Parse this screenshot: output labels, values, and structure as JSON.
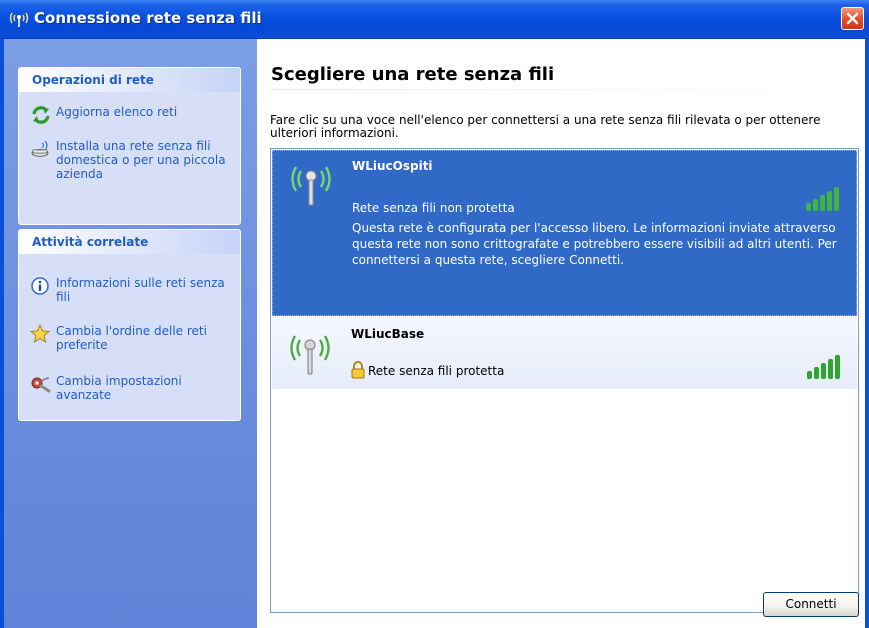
{
  "window": {
    "title": "Connessione rete senza fili"
  },
  "sidebar": {
    "network_tasks": {
      "header": "Operazioni di rete",
      "items": [
        {
          "label": "Aggiorna elenco reti",
          "icon": "refresh-icon"
        },
        {
          "label": "Installa una rete senza fili domestica o per una piccola azienda",
          "icon": "wireless-setup-icon"
        }
      ]
    },
    "related_tasks": {
      "header": "Attività correlate",
      "items": [
        {
          "label": "Informazioni sulle reti senza fili",
          "icon": "info-icon"
        },
        {
          "label": "Cambia l'ordine delle reti preferite",
          "icon": "star-icon"
        },
        {
          "label": "Cambia impostazioni avanzate",
          "icon": "settings-icon"
        }
      ]
    }
  },
  "main": {
    "title": "Scegliere una rete senza fili",
    "instructions": "Fare clic su una voce nell'elenco per connettersi a una rete senza fili rilevata o per ottenere ulteriori informazioni.",
    "networks": [
      {
        "ssid": "WLiucOspiti",
        "security": "Rete senza fili non protetta",
        "description": "Questa rete è configurata per l'accesso libero. Le informazioni inviate attraverso questa rete non sono crittografate e potrebbero essere visibili ad altri utenti. Per connettersi a questa rete, scegliere Connetti.",
        "selected": true,
        "signal_bars": 5
      },
      {
        "ssid": "WLiucBase",
        "security": "Rete senza fili protetta",
        "selected": false,
        "signal_bars": 5
      }
    ],
    "connect_label": "Connetti"
  },
  "colors": {
    "titlebar": "#0a52e3",
    "selection": "#3169c6",
    "signal": "#2ea52e",
    "link": "#215dc6"
  }
}
